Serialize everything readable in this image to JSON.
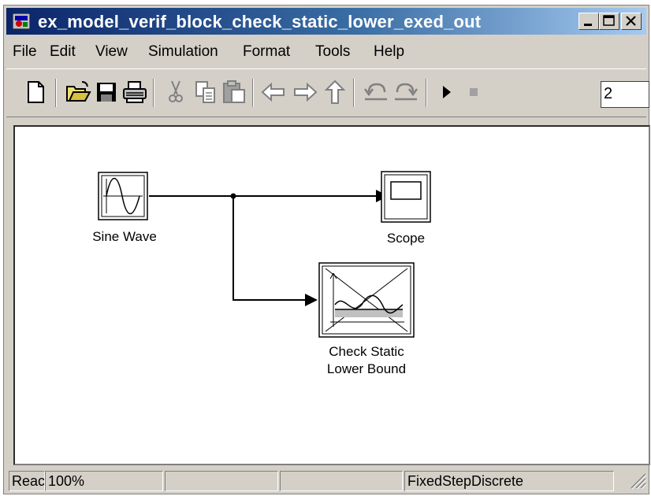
{
  "window": {
    "title": "ex_model_verif_block_check_static_lower_exed_out",
    "caption_buttons": [
      "minimize",
      "maximize",
      "close"
    ]
  },
  "menu": [
    "File",
    "Edit",
    "View",
    "Simulation",
    "Format",
    "Tools",
    "Help"
  ],
  "toolbar": {
    "icons": [
      "new-model-icon",
      "open-folder-icon",
      "save-icon",
      "print-icon",
      "cut-icon",
      "copy-icon",
      "paste-icon",
      "back-arrow-icon",
      "forward-arrow-icon",
      "up-arrow-icon",
      "undo-icon",
      "redo-icon",
      "start-simulation-icon",
      "stop-simulation-icon"
    ],
    "stop_time": "2"
  },
  "model": {
    "blocks": {
      "sine_wave": "Sine Wave",
      "scope": "Scope",
      "check_static_line1": "Check Static",
      "check_static_line2": "Lower Bound"
    }
  },
  "status": {
    "state": "Reac",
    "zoom": "100%",
    "field3": "",
    "field4": "",
    "solver": "FixedStepDiscrete"
  },
  "colors": {
    "title_start": "#0a246a",
    "title_end": "#a6caf0",
    "chrome": "#d4d0c8"
  }
}
